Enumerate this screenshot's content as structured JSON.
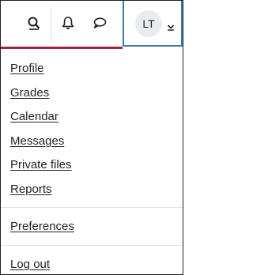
{
  "navbar": {
    "icons": [
      {
        "name": "search-icon"
      },
      {
        "name": "notifications-icon"
      },
      {
        "name": "messages-icon"
      }
    ],
    "user_initials": "LT",
    "accent_underline_color": "#a4233c",
    "user_menu_outline_color": "#3e7ca8"
  },
  "user_menu": {
    "items": [
      {
        "label": "Profile"
      },
      {
        "label": "Grades"
      },
      {
        "label": "Calendar"
      },
      {
        "label": "Messages"
      },
      {
        "label": "Private files"
      },
      {
        "label": "Reports"
      },
      {
        "label": "Preferences"
      },
      {
        "label": "Log out"
      }
    ]
  }
}
